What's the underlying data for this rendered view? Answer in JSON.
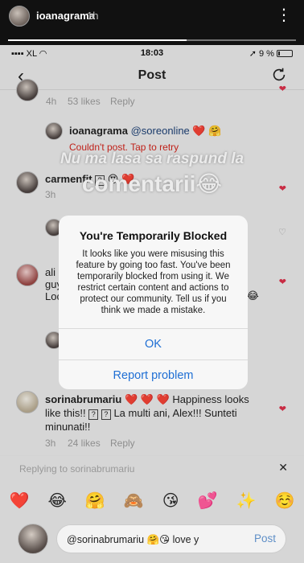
{
  "story": {
    "username": "ioanagrama",
    "time": "1h",
    "more_icon": "⋮",
    "close_icon": "✕"
  },
  "statusbar": {
    "carrier": "XL",
    "time": "18:03",
    "battery": "9 %"
  },
  "navbar": {
    "title": "Post",
    "back_icon": "‹",
    "refresh_icon": "refresh-icon"
  },
  "comments": [
    {
      "id": "c0",
      "meta_time": "4h",
      "meta_likes": "53 likes",
      "meta_reply": "Reply"
    },
    {
      "id": "c1",
      "username": "ioanagrama",
      "mention": "@soreonline",
      "emojis": "❤️ 🤗",
      "error": "Couldn't post. Tap to retry"
    },
    {
      "id": "c2",
      "username": "carmenfit",
      "emojis": "😍 ❤️",
      "meta_time": "3h"
    },
    {
      "id": "c3",
      "username": "ali",
      "text2": "guy",
      "text3": "Loc"
    },
    {
      "id": "c4",
      "username": "sorinabrumariu",
      "text": "❤️ ❤️ ❤️ Happiness looks like this!!",
      "text_b": "La multi ani, Alex!!! Sunteti minunati!!",
      "meta_time": "3h",
      "meta_likes": "24 likes",
      "meta_reply": "Reply"
    }
  ],
  "overlay": {
    "line1": "Nu ma lasa sa raspund la",
    "line2": "comentarii😂"
  },
  "dialog": {
    "title": "You're Temporarily Blocked",
    "body": "It looks like you were misusing this feature by going too fast. You've been temporarily blocked from using it. We restrict certain content and actions to protect our community. Tell us if you think we made a mistake.",
    "ok": "OK",
    "report": "Report problem"
  },
  "reply": {
    "label": "Replying to sorinabrumariu",
    "close_icon": "✕"
  },
  "emojis": [
    "❤️",
    "😂",
    "🤗",
    "🙈",
    "😘",
    "💕",
    "✨",
    "☺️"
  ],
  "input": {
    "value": "@sorinabrumariu 🤗😘 love y",
    "post": "Post"
  },
  "colors": {
    "error": "#d0241c",
    "link": "#1f6fd4",
    "heart": "#d9304a"
  }
}
